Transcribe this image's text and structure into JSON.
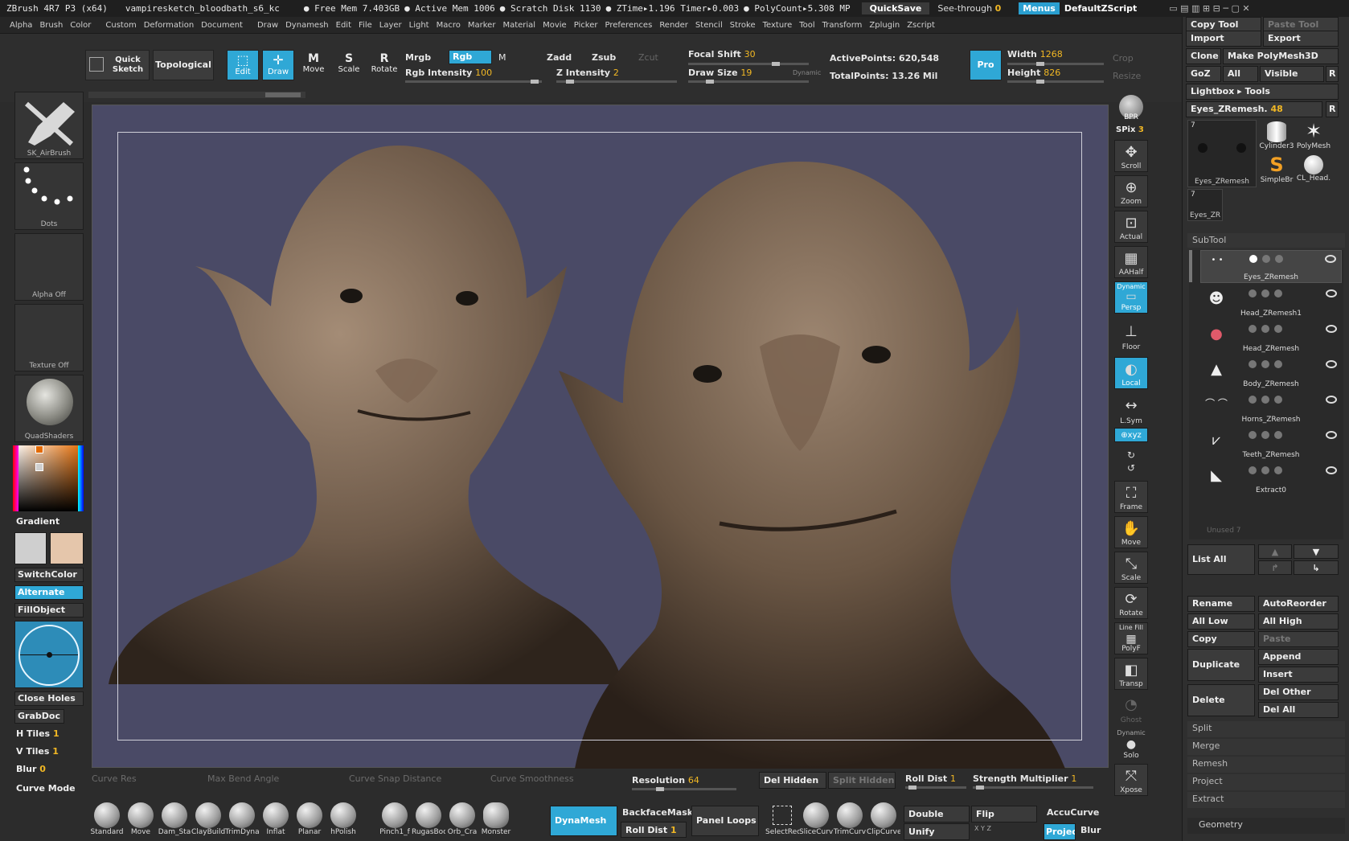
{
  "titlebar": {
    "app": "ZBrush 4R7 P3 (x64)",
    "file": "vampiresketch_bloodbath_s6_kc",
    "free_mem": "● Free Mem 7.403GB",
    "active_mem": "● Active Mem 1006",
    "scratch": "● Scratch Disk 1130",
    "ztime": "● ZTime▸1.196 Timer▸0.003",
    "polycount": "● PolyCount▸5.308 MP",
    "quicksave": "QuickSave",
    "seethrough_label": "See-through",
    "seethrough_value": "0",
    "menus": "Menus",
    "script": "DefaultZScript"
  },
  "menubar": [
    "Alpha",
    "Brush",
    "Color",
    "Custom",
    "Deformation",
    "Document",
    "Draw",
    "Dynamesh",
    "Edit",
    "File",
    "Layer",
    "Light",
    "Macro",
    "Marker",
    "Material",
    "Movie",
    "Picker",
    "Preferences",
    "Render",
    "Stencil",
    "Stroke",
    "Texture",
    "Tool",
    "Transform",
    "Zplugin",
    "Zscript"
  ],
  "toolbar": {
    "quick_sketch": "Quick Sketch",
    "topological": "Topological",
    "edit": "Edit",
    "draw": "Draw",
    "move": "Move",
    "scale": "Scale",
    "rotate": "Rotate",
    "mrgb": "Mrgb",
    "rgb": "Rgb",
    "m": "M",
    "zadd": "Zadd",
    "zsub": "Zsub",
    "zcut": "Zcut",
    "rgb_intensity_label": "Rgb Intensity",
    "rgb_intensity_value": "100",
    "z_intensity_label": "Z Intensity",
    "z_intensity_value": "2",
    "focal_shift_label": "Focal Shift",
    "focal_shift_value": "30",
    "draw_size_label": "Draw Size",
    "draw_size_value": "19",
    "dynamic": "Dynamic",
    "active_points": "ActivePoints: 620,548",
    "total_points": "TotalPoints: 13.26 Mil",
    "pro": "Pro",
    "width_label": "Width",
    "width_value": "1268",
    "height_label": "Height",
    "height_value": "826",
    "crop": "Crop",
    "resize": "Resize"
  },
  "leftshelf": {
    "brush": "SK_AirBrush",
    "stroke": "Dots",
    "alpha": "Alpha  Off",
    "texture": "Texture  Off",
    "material": "QuadShaders",
    "gradient": "Gradient",
    "switchcolor": "SwitchColor",
    "alternate": "Alternate",
    "fillobject": "FillObject",
    "close_holes": "Close Holes",
    "grabdoc": "GrabDoc",
    "h_tiles_label": "H Tiles",
    "h_tiles_value": "1",
    "v_tiles_label": "V Tiles",
    "v_tiles_value": "1",
    "blur_label": "Blur",
    "blur_value": "0",
    "curve_mode": "Curve Mode",
    "primary_color": "#cfcfcf",
    "secondary_color": "#e5c6ab"
  },
  "rightshelf": {
    "bpr": "BPR",
    "spix_label": "SPix",
    "spix_value": "3",
    "scroll": "Scroll",
    "zoom": "Zoom",
    "actual": "Actual",
    "aahalf": "AAHalf",
    "dynamic": "Dynamic",
    "persp": "Persp",
    "floor": "Floor",
    "local": "Local",
    "lsym": "L.Sym",
    "xyz": "⊕xyz",
    "frame": "Frame",
    "move": "Move",
    "scale": "Scale",
    "rotate": "Rotate",
    "linefill": "Line Fill",
    "polyf": "PolyF",
    "transp": "Transp",
    "ghost": "Ghost",
    "dynamic2": "Dynamic",
    "solo": "Solo",
    "xpose": "Xpose"
  },
  "tool": {
    "copy_tool": "Copy  Tool",
    "paste_tool": "Paste  Tool",
    "import": "Import",
    "export": "Export",
    "clone": "Clone",
    "make_polymesh": "Make PolyMesh3D",
    "goz": "GoZ",
    "all": "All",
    "visible": "Visible",
    "r": "R",
    "lightbox": "Lightbox ▸ Tools",
    "current_label": "Eyes_ZRemesh.",
    "current_value": "48",
    "thumb_count": "7",
    "thumb_count2": "7",
    "thumb_name": "Eyes_ZRemesh",
    "thumb_name2": "Eyes_ZR",
    "tools": [
      "Cylinder3",
      "PolyMesh",
      "SimpleBr",
      "CL_Head."
    ]
  },
  "subtool": {
    "header": "SubTool",
    "items": [
      "Eyes_ZRemesh",
      "Head_ZRemesh1",
      "Head_ZRemesh",
      "Body_ZRemesh",
      "Horns_ZRemesh",
      "Teeth_ZRemesh",
      "Extract0"
    ],
    "unused": "Unused  7",
    "list_all": "List  All",
    "rename": "Rename",
    "autoreorder": "AutoReorder",
    "all_low": "All  Low",
    "all_high": "All  High",
    "copy": "Copy",
    "paste": "Paste",
    "duplicate": "Duplicate",
    "append": "Append",
    "insert": "Insert",
    "delete": "Delete",
    "del_other": "Del  Other",
    "del_all": "Del  All",
    "split": "Split",
    "merge": "Merge",
    "remesh": "Remesh",
    "project": "Project",
    "extract": "Extract",
    "geometry": "Geometry"
  },
  "bottom": {
    "curve_res": "Curve Res",
    "max_bend": "Max Bend Angle",
    "curve_snap": "Curve Snap Distance",
    "curve_smooth": "Curve Smoothness",
    "resolution_label": "Resolution",
    "resolution_value": "64",
    "del_hidden": "Del Hidden",
    "split_hidden": "Split Hidden",
    "roll_dist_label": "Roll Dist",
    "roll_dist_value": "1",
    "strength_label": "Strength Multiplier",
    "strength_value": "1",
    "brushes": [
      "Standard",
      "Move",
      "Dam_Sta",
      "ClayBuild",
      "TrimDyna",
      "Inflat",
      "Planar",
      "hPolish",
      "Pinch1_f",
      "RugasBoo",
      "Orb_Cra",
      "Monster"
    ],
    "dynamesh": "DynaMesh",
    "backfacemask": "BackfaceMask",
    "roll_dist2_label": "Roll Dist",
    "roll_dist2_value": "1",
    "panel_loops": "Panel Loops",
    "tools": [
      "SelectRec",
      "SliceCurv",
      "TrimCurv",
      "ClipCurve"
    ],
    "double": "Double",
    "flip": "Flip",
    "unify": "Unify",
    "accucurve": "AccuCurve",
    "project": "Projec",
    "blur": "Blur"
  }
}
